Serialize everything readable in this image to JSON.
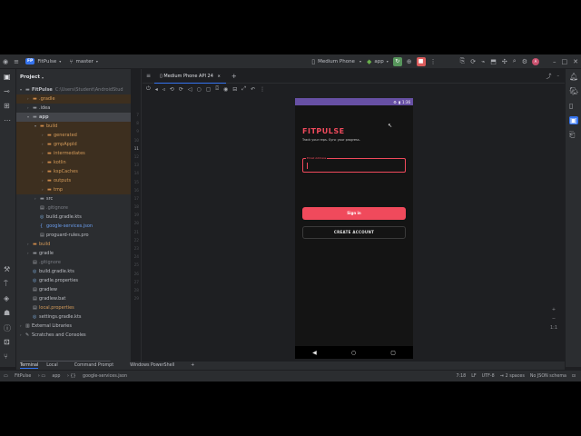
{
  "titlebar": {
    "project_badge": "FP",
    "project_name": "FitPulse",
    "branch": "master",
    "device": "Medium Phone",
    "run_config": "app"
  },
  "project_panel": {
    "title": "Project",
    "tree": [
      {
        "label": "FitPulse",
        "path": "C:\\Users\\Student\\AndroidStud",
        "depth": 0,
        "icon": "folder",
        "kind": "root"
      },
      {
        "label": ".gradle",
        "depth": 1,
        "icon": "folder",
        "kind": "excluded"
      },
      {
        "label": ".idea",
        "depth": 1,
        "icon": "folder",
        "kind": "normal"
      },
      {
        "label": "app",
        "depth": 1,
        "icon": "folder",
        "kind": "selected"
      },
      {
        "label": "build",
        "depth": 2,
        "icon": "folder",
        "kind": "excluded"
      },
      {
        "label": "generated",
        "depth": 3,
        "icon": "folder",
        "kind": "excluded"
      },
      {
        "label": "gmpAppId",
        "depth": 3,
        "icon": "folder",
        "kind": "excluded"
      },
      {
        "label": "intermediates",
        "depth": 3,
        "icon": "folder",
        "kind": "excluded"
      },
      {
        "label": "kotlin",
        "depth": 3,
        "icon": "folder",
        "kind": "excluded"
      },
      {
        "label": "kspCaches",
        "depth": 3,
        "icon": "folder",
        "kind": "excluded"
      },
      {
        "label": "outputs",
        "depth": 3,
        "icon": "folder",
        "kind": "excluded"
      },
      {
        "label": "tmp",
        "depth": 3,
        "icon": "folder",
        "kind": "excluded"
      },
      {
        "label": "src",
        "depth": 2,
        "icon": "folder",
        "kind": "normal"
      },
      {
        "label": ".gitignore",
        "depth": 2,
        "icon": "file",
        "kind": "grey"
      },
      {
        "label": "build.gradle.kts",
        "depth": 2,
        "icon": "gradle",
        "kind": "normal"
      },
      {
        "label": "google-services.json",
        "depth": 2,
        "icon": "json",
        "kind": "blue"
      },
      {
        "label": "proguard-rules.pro",
        "depth": 2,
        "icon": "file",
        "kind": "normal"
      },
      {
        "label": "build",
        "depth": 1,
        "icon": "folder",
        "kind": "orange"
      },
      {
        "label": "gradle",
        "depth": 1,
        "icon": "folder",
        "kind": "normal"
      },
      {
        "label": ".gitignore",
        "depth": 1,
        "icon": "file",
        "kind": "grey"
      },
      {
        "label": "build.gradle.kts",
        "depth": 1,
        "icon": "gradle",
        "kind": "normal"
      },
      {
        "label": "gradle.properties",
        "depth": 1,
        "icon": "gradle",
        "kind": "normal"
      },
      {
        "label": "gradlew",
        "depth": 1,
        "icon": "file",
        "kind": "normal"
      },
      {
        "label": "gradlew.bat",
        "depth": 1,
        "icon": "file",
        "kind": "normal"
      },
      {
        "label": "local.properties",
        "depth": 1,
        "icon": "file",
        "kind": "orange"
      },
      {
        "label": "settings.gradle.kts",
        "depth": 1,
        "icon": "gradle",
        "kind": "normal"
      },
      {
        "label": "External Libraries",
        "depth": 0,
        "icon": "lib",
        "kind": "normal"
      },
      {
        "label": "Scratches and Consoles",
        "depth": 0,
        "icon": "scratch",
        "kind": "normal"
      }
    ]
  },
  "gutter_lines": [
    "7",
    "8",
    "9",
    "10",
    "11",
    "12",
    "13",
    "14",
    "15",
    "16",
    "17",
    "18",
    "19",
    "20",
    "21",
    "22",
    "23",
    "24",
    "25",
    "26",
    "27",
    "28",
    "29"
  ],
  "devices": {
    "tab_label": "Medium Phone API 24",
    "add_label": "+"
  },
  "phone": {
    "time": "1:36",
    "app_title": "FITPULSE",
    "app_subtitle": "Track your reps. Sync your progress.",
    "email_label": "Email Address",
    "signin_label": "Sign in",
    "create_label": "CREATE ACCOUNT"
  },
  "zoom": {
    "plus": "+",
    "ratio": "1:1",
    "minus": "−"
  },
  "terminal": {
    "tabs": [
      "Terminal",
      "Local",
      "Command Prompt",
      "Windows PowerShell"
    ],
    "add": "+"
  },
  "statusbar": {
    "breadcrumb": [
      "FitPulse",
      "app",
      "google-services.json"
    ],
    "position": "7:18",
    "line_sep": "LF",
    "encoding": "UTF-8",
    "indent": "2 spaces",
    "schema": "No JSON schema"
  },
  "colors": {
    "accent": "#3574f0",
    "brand": "#f04a5c",
    "status_bar": "#6750a4"
  }
}
